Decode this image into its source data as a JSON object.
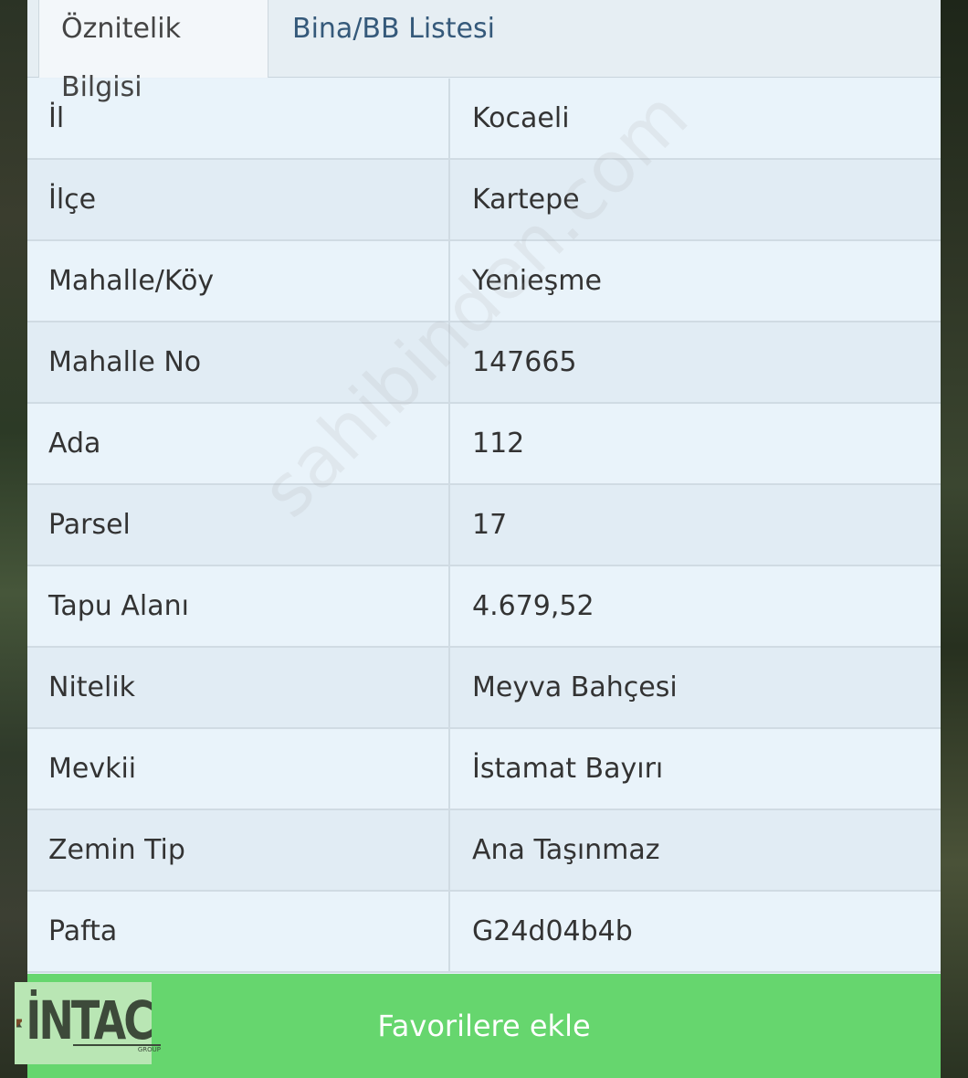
{
  "tabs": [
    {
      "label": "Öznitelik Bilgisi",
      "active": true
    },
    {
      "label": "Bina/BB Listesi",
      "active": false
    }
  ],
  "rows": [
    {
      "key": "İl",
      "value": "Kocaeli"
    },
    {
      "key": "İlçe",
      "value": "Kartepe"
    },
    {
      "key": "Mahalle/Köy",
      "value": "Yenieşme"
    },
    {
      "key": "Mahalle No",
      "value": "147665"
    },
    {
      "key": "Ada",
      "value": "112"
    },
    {
      "key": "Parsel",
      "value": "17"
    },
    {
      "key": "Tapu Alanı",
      "value": "4.679,52"
    },
    {
      "key": "Nitelik",
      "value": "Meyva Bahçesi"
    },
    {
      "key": "Mevkii",
      "value": "İstamat Bayırı"
    },
    {
      "key": "Zemin Tip",
      "value": "Ana Taşınmaz"
    },
    {
      "key": "Pafta",
      "value": "G24d04b4b"
    }
  ],
  "favorite_button": {
    "label": "Favorilere ekle",
    "color": "#66d66e"
  },
  "logo": {
    "text": "İNTAC",
    "subtext": "GROUP"
  },
  "watermark": {
    "text": "sahibinden.com"
  },
  "colors": {
    "panel_bg": "#e7f1f8",
    "tab_text_inactive": "#35597a",
    "button_green": "#66d66e"
  }
}
